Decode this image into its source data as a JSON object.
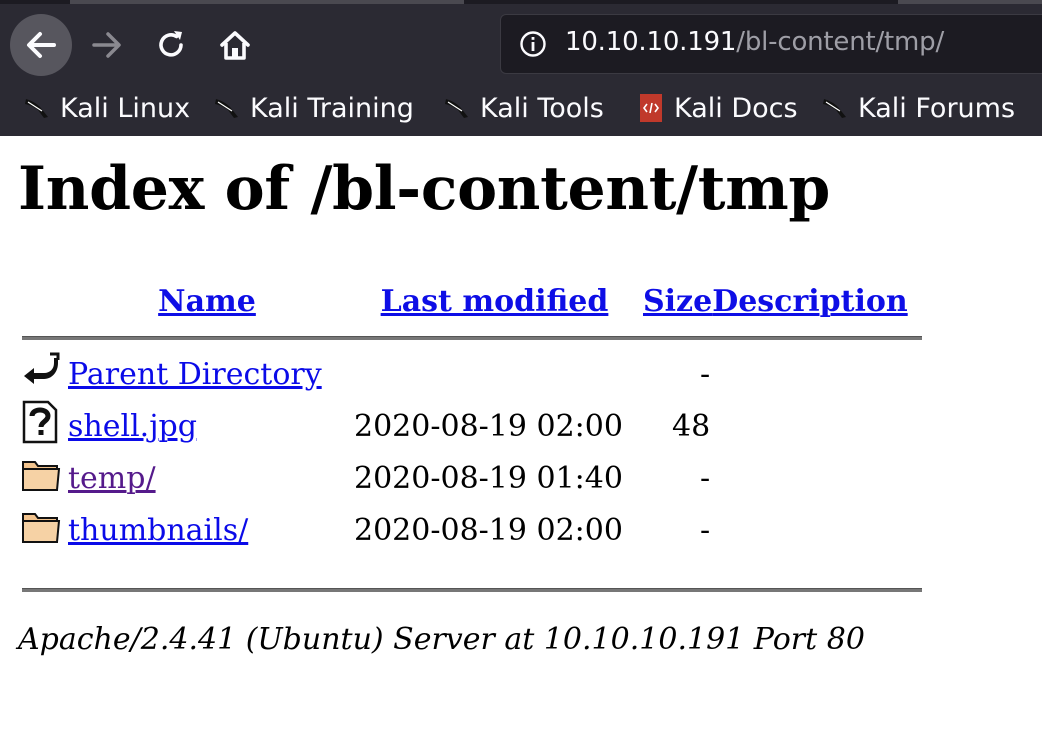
{
  "browser": {
    "url_host": "10.10.10.191",
    "url_path": "/bl-content/tmp/",
    "bookmarks": [
      {
        "label": "Kali Linux",
        "icon": "kali-dragon-icon"
      },
      {
        "label": "Kali Training",
        "icon": "kali-dragon-icon"
      },
      {
        "label": "Kali Tools",
        "icon": "kali-dragon-icon"
      },
      {
        "label": "Kali Docs",
        "icon": "kali-docs-icon"
      },
      {
        "label": "Kali Forums",
        "icon": "kali-dragon-icon"
      }
    ],
    "colors": {
      "chrome_bg": "#2b2a33",
      "urlbar_bg": "#1c1b22",
      "link": "#0b0be8",
      "visited": "#551a8b"
    }
  },
  "page": {
    "title": "Index of /bl-content/tmp",
    "headers": {
      "name": "Name",
      "last_modified": "Last modified",
      "size": "Size",
      "description": "Description"
    },
    "rows": [
      {
        "icon": "parent-directory-icon",
        "name": "Parent Directory",
        "modified": "",
        "size": "-",
        "description": ""
      },
      {
        "icon": "unknown-file-icon",
        "name": "shell.jpg",
        "modified": "2020-08-19 02:00",
        "size": "48",
        "description": ""
      },
      {
        "icon": "folder-icon",
        "name": "temp/",
        "modified": "2020-08-19 01:40",
        "size": "-",
        "description": ""
      },
      {
        "icon": "folder-icon",
        "name": "thumbnails/",
        "modified": "2020-08-19 02:00",
        "size": "-",
        "description": ""
      }
    ],
    "footer": "Apache/2.4.41 (Ubuntu) Server at 10.10.10.191 Port 80"
  }
}
